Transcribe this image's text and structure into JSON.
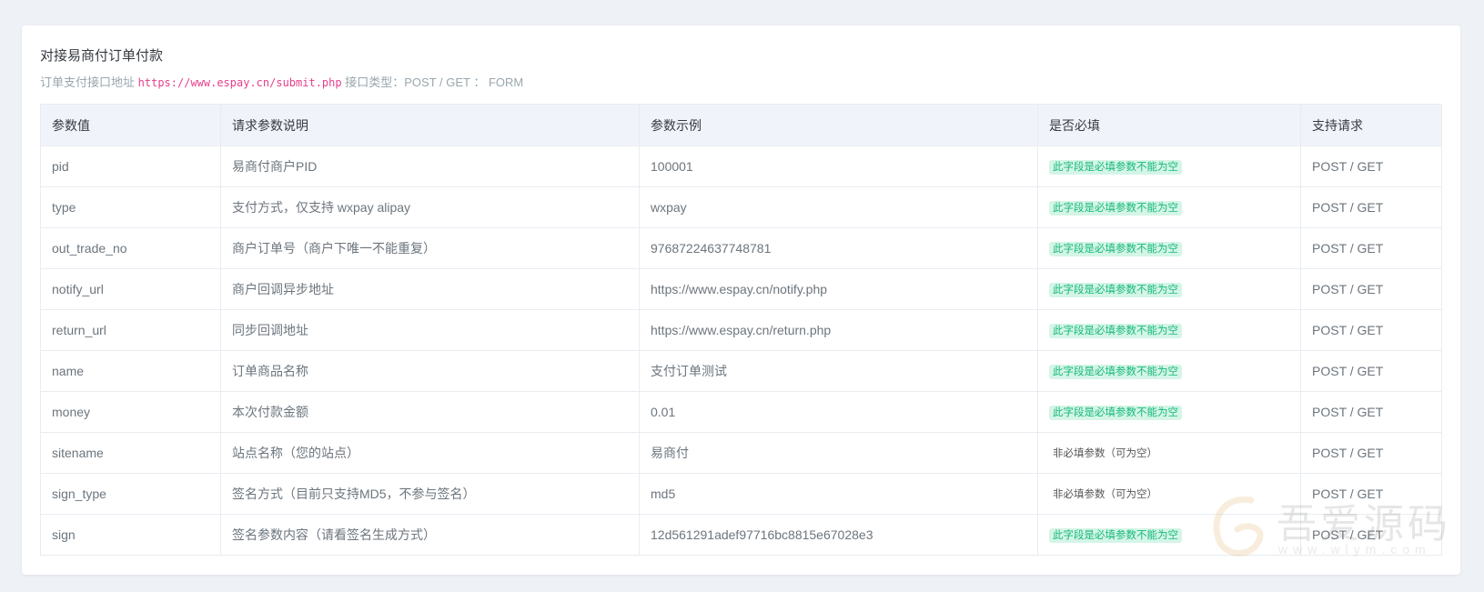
{
  "section": {
    "title": "对接易商付订单付款",
    "subtitle_prefix": "订单支付接口地址",
    "endpoint_url": "https://www.espay.cn/submit.php",
    "subtitle_suffix": "接口类型：POST / GET ： FORM"
  },
  "table": {
    "headers": [
      "参数值",
      "请求参数说明",
      "参数示例",
      "是否必填",
      "支持请求"
    ],
    "rows": [
      {
        "param": "pid",
        "desc": "易商付商户PID",
        "example": "100001",
        "required": "此字段是必填参数不能为空",
        "required_flag": true,
        "method": "POST / GET"
      },
      {
        "param": "type",
        "desc": "支付方式，仅支持 wxpay alipay",
        "example": "wxpay",
        "required": "此字段是必填参数不能为空",
        "required_flag": true,
        "method": "POST / GET"
      },
      {
        "param": "out_trade_no",
        "desc": "商户订单号（商户下唯一不能重复）",
        "example": "97687224637748781",
        "required": "此字段是必填参数不能为空",
        "required_flag": true,
        "method": "POST / GET"
      },
      {
        "param": "notify_url",
        "desc": "商户回调异步地址",
        "example": "https://www.espay.cn/notify.php",
        "required": "此字段是必填参数不能为空",
        "required_flag": true,
        "method": "POST / GET"
      },
      {
        "param": "return_url",
        "desc": "同步回调地址",
        "example": "https://www.espay.cn/return.php",
        "required": "此字段是必填参数不能为空",
        "required_flag": true,
        "method": "POST / GET"
      },
      {
        "param": "name",
        "desc": "订单商品名称",
        "example": "支付订单测试",
        "required": "此字段是必填参数不能为空",
        "required_flag": true,
        "method": "POST / GET"
      },
      {
        "param": "money",
        "desc": "本次付款金额",
        "example": "0.01",
        "required": "此字段是必填参数不能为空",
        "required_flag": true,
        "method": "POST / GET"
      },
      {
        "param": "sitename",
        "desc": "站点名称（您的站点）",
        "example": "易商付",
        "required": "非必填参数（可为空）",
        "required_flag": false,
        "method": "POST / GET"
      },
      {
        "param": "sign_type",
        "desc": "签名方式（目前只支持MD5，不参与签名）",
        "example": "md5",
        "required": "非必填参数（可为空）",
        "required_flag": false,
        "method": "POST / GET"
      },
      {
        "param": "sign",
        "desc": "签名参数内容（请看签名生成方式）",
        "example": "12d561291adef97716bc8815e67028e3",
        "required": "此字段是必填参数不能为空",
        "required_flag": true,
        "method": "POST / GET"
      }
    ]
  },
  "watermark": {
    "text": "吾爱源码",
    "domain": "www.wlym.com"
  },
  "colors": {
    "page_bg": "#eef1f6",
    "code": "#e83e8c",
    "required_badge_bg": "#d4f5e7",
    "required_badge_text": "#16b97a"
  }
}
